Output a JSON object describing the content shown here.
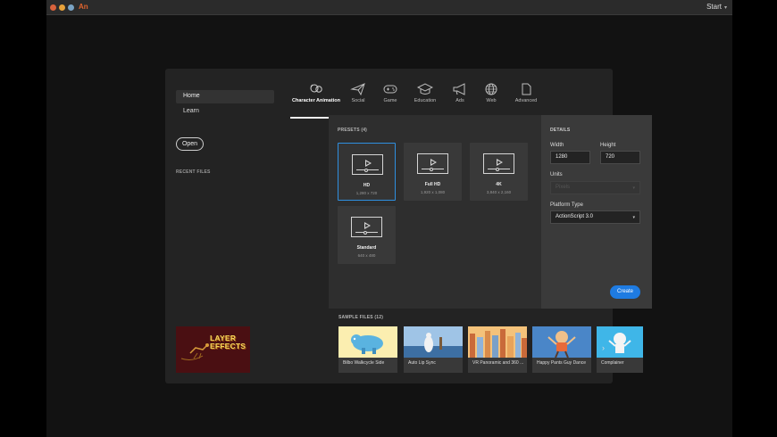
{
  "titlebar": {
    "app_logo": "An",
    "workspace_label": "Start",
    "workspace_chevron": "▾"
  },
  "sidebar": {
    "items": [
      {
        "label": "Home",
        "active": true
      },
      {
        "label": "Learn",
        "active": false
      }
    ],
    "open_label": "Open",
    "recent_label": "RECENT FILES"
  },
  "categories": [
    {
      "label": "Character Animation",
      "icon": "character-animation-icon",
      "active": true
    },
    {
      "label": "Social",
      "icon": "paper-plane-icon",
      "active": false
    },
    {
      "label": "Game",
      "icon": "gamepad-icon",
      "active": false
    },
    {
      "label": "Education",
      "icon": "graduation-cap-icon",
      "active": false
    },
    {
      "label": "Ads",
      "icon": "megaphone-icon",
      "active": false
    },
    {
      "label": "Web",
      "icon": "globe-icon",
      "active": false
    },
    {
      "label": "Advanced",
      "icon": "document-icon",
      "active": false
    }
  ],
  "presets": {
    "label": "PRESETS (4)",
    "items": [
      {
        "name": "HD",
        "resolution": "1,280 x 720",
        "selected": true
      },
      {
        "name": "Full HD",
        "resolution": "1,920 x 1,080",
        "selected": false
      },
      {
        "name": "4K",
        "resolution": "3,840 x 2,160",
        "selected": false
      },
      {
        "name": "Standard",
        "resolution": "640 x 480",
        "selected": false
      }
    ]
  },
  "details": {
    "label": "DETAILS",
    "width_label": "Width",
    "width_value": "1280",
    "height_label": "Height",
    "height_value": "720",
    "units_label": "Units",
    "units_value": "Pixels",
    "platform_label": "Platform Type",
    "platform_value": "ActionScript 3.0",
    "create_label": "Create"
  },
  "samples": {
    "label": "SAMPLE FILES (12)",
    "promo_title_line1": "LAYER",
    "promo_title_line2": "EFFECTS",
    "items": [
      {
        "title": "Bilbo Walkcycle Side"
      },
      {
        "title": "Auto Lip Sync"
      },
      {
        "title": "VR Panoramic and 360 ..."
      },
      {
        "title": "Happy Pants Guy Dance"
      },
      {
        "title": "Complainer"
      }
    ],
    "next_arrow": "›"
  },
  "colors": {
    "accent": "#1e7be2",
    "selected_border": "#2f8fe0",
    "app_brand": "#e0632d"
  }
}
